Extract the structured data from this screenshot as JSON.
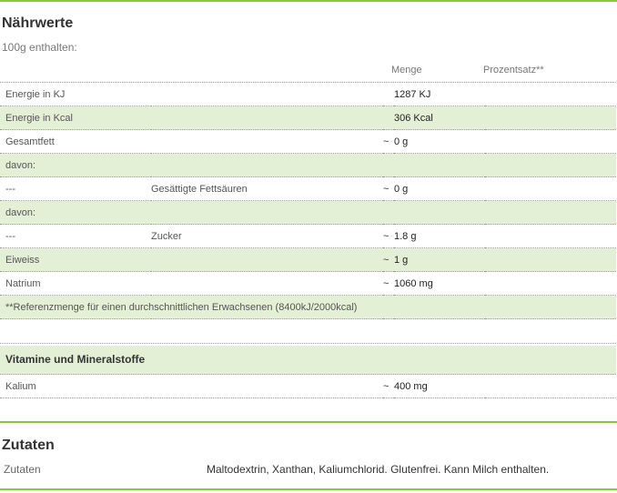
{
  "naehrwerte": {
    "title": "Nährwerte",
    "subtitle": "100g enthalten:",
    "columns": {
      "menge": "Menge",
      "prozentsatz": "Prozentsatz**"
    },
    "rows": [
      {
        "label": "Energie in KJ",
        "sub": "",
        "tilde": "",
        "value": "1287 KJ",
        "percent": ""
      },
      {
        "label": "Energie in Kcal",
        "sub": "",
        "tilde": "",
        "value": "306 Kcal",
        "percent": ""
      },
      {
        "label": "Gesamtfett",
        "sub": "",
        "tilde": "~",
        "value": "0 g",
        "percent": ""
      },
      {
        "label": "davon:",
        "sub": "",
        "tilde": "",
        "value": "",
        "percent": ""
      },
      {
        "label": "---",
        "sub": "Gesättigte Fettsäuren",
        "tilde": "~",
        "value": "0 g",
        "percent": ""
      },
      {
        "label": "davon:",
        "sub": "",
        "tilde": "",
        "value": "",
        "percent": ""
      },
      {
        "label": "---",
        "sub": "Zucker",
        "tilde": "~",
        "value": "1.8 g",
        "percent": ""
      },
      {
        "label": "Eiweiss",
        "sub": "",
        "tilde": "~",
        "value": "1 g",
        "percent": ""
      },
      {
        "label": "Natrium",
        "sub": "",
        "tilde": "~",
        "value": "1060 mg",
        "percent": ""
      }
    ],
    "footnote": "**Referenzmenge für einen durchschnittlichen Erwachsenen (8400kJ/2000kcal)"
  },
  "vitamine": {
    "title": "Vitamine und Mineralstoffe",
    "rows": [
      {
        "label": "Kalium",
        "tilde": "~",
        "value": "400 mg"
      }
    ]
  },
  "zutaten": {
    "title": "Zutaten",
    "label": "Zutaten",
    "value": "Maltodextrin, Xanthan, Kaliumchlorid. Glutenfrei. Kann Milch enthalten."
  },
  "colors": {
    "accent_line": "#8cc63f",
    "row_alt": "#e4f0d5"
  }
}
